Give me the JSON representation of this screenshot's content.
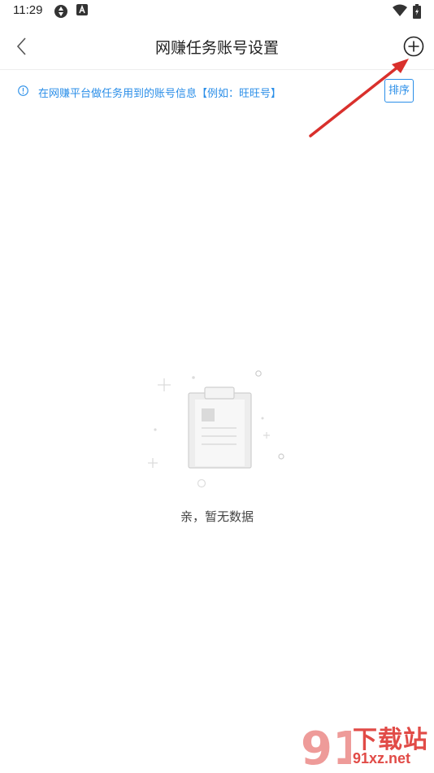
{
  "status_bar": {
    "time": "11:29",
    "icons": [
      "sync-icon",
      "a-letter-icon",
      "wifi-icon",
      "battery-icon"
    ]
  },
  "header": {
    "title": "网赚任务账号设置",
    "back_icon": "chevron-left-icon",
    "add_icon": "plus-circle-icon"
  },
  "notice": {
    "icon": "info-circle-icon",
    "text": "在网赚平台做任务用到的账号信息【例如：旺旺号】",
    "sort_label": "排序"
  },
  "empty_state": {
    "icon": "empty-clipboard-illustration",
    "message": "亲，暂无数据"
  },
  "watermark": {
    "logo": "91",
    "text": "下载站",
    "url": "91xz.net"
  },
  "colors": {
    "accent": "#2a8ee8",
    "arrow": "#d9302c",
    "watermark": "#e14b47"
  }
}
